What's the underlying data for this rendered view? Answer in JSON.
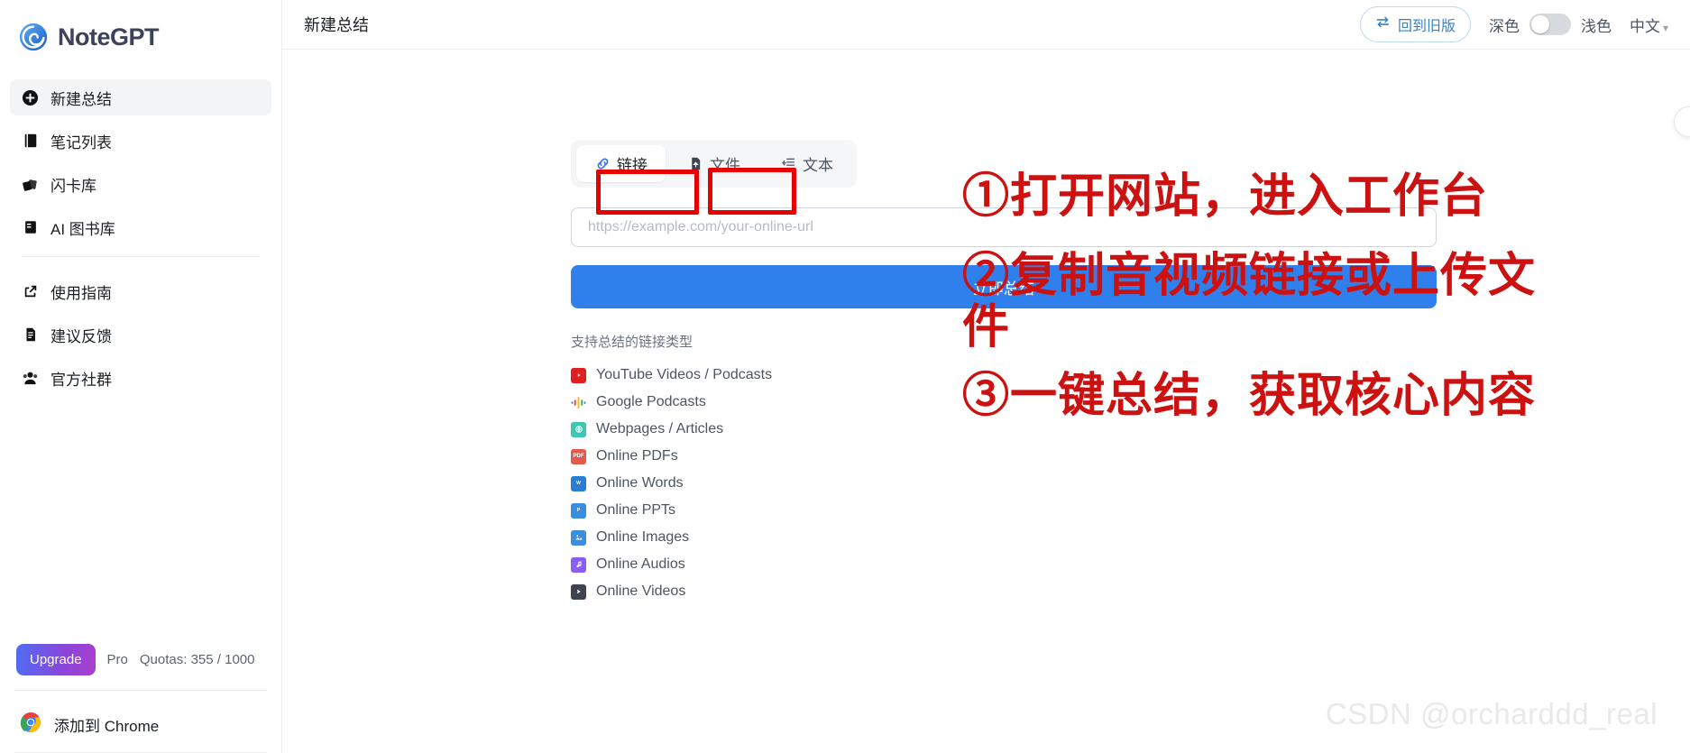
{
  "brand": {
    "name": "NoteGPT",
    "logo_icon": "spiral-logo-icon"
  },
  "sidebar": {
    "primary_items": [
      {
        "label": "新建总结",
        "icon": "plus-circle-icon",
        "active": true
      },
      {
        "label": "笔记列表",
        "icon": "notebook-icon",
        "active": false
      },
      {
        "label": "闪卡库",
        "icon": "flashcards-icon",
        "active": false
      },
      {
        "label": "AI 图书库",
        "icon": "book-icon",
        "active": false
      }
    ],
    "secondary_items": [
      {
        "label": "使用指南",
        "icon": "external-link-icon"
      },
      {
        "label": "建议反馈",
        "icon": "document-icon"
      },
      {
        "label": "官方社群",
        "icon": "users-group-icon"
      }
    ],
    "upgrade_label": "Upgrade",
    "plan_label": "Pro",
    "quota_label": "Quotas: 355 / 1000",
    "chrome_label": "添加到 Chrome",
    "chrome_icon": "chrome-icon"
  },
  "header": {
    "title": "新建总结",
    "legacy_button": {
      "label": "回到旧版",
      "icon": "swap-arrows-icon"
    },
    "theme": {
      "dark_label": "深色",
      "light_label": "浅色",
      "toggle_state": "off"
    },
    "language": {
      "label": "中文",
      "caret": "▾"
    }
  },
  "main": {
    "tabs": [
      {
        "label": "链接",
        "icon": "link-icon",
        "active": true
      },
      {
        "label": "文件",
        "icon": "file-upload-icon",
        "active": false
      },
      {
        "label": "文本",
        "icon": "text-lines-icon",
        "active": false
      }
    ],
    "url_input": {
      "value": "",
      "placeholder": "https://example.com/your-online-url"
    },
    "submit_label": "立即总结",
    "types_title": "支持总结的链接类型",
    "types": [
      {
        "label": "YouTube Videos / Podcasts",
        "icon": "youtube-icon",
        "color": "#e02020"
      },
      {
        "label": "Google Podcasts",
        "icon": "google-podcasts-icon",
        "color": "#f7c948"
      },
      {
        "label": "Webpages / Articles",
        "icon": "webpage-icon",
        "color": "#3fc6b3"
      },
      {
        "label": "Online PDFs",
        "icon": "pdf-icon",
        "color": "#e25b4a"
      },
      {
        "label": "Online Words",
        "icon": "word-icon",
        "color": "#2b7cd3"
      },
      {
        "label": "Online PPTs",
        "icon": "ppt-icon",
        "color": "#3a8edd"
      },
      {
        "label": "Online Images",
        "icon": "image-icon",
        "color": "#3a8edd"
      },
      {
        "label": "Online Audios",
        "icon": "audio-icon",
        "color": "#8b5cf6"
      },
      {
        "label": "Online Videos",
        "icon": "video-icon",
        "color": "#3f4450"
      }
    ]
  },
  "annotations": {
    "accent_color": "#cc1111",
    "box_color": "#e60000",
    "steps": [
      "①打开网站，进入工作台",
      "②复制音视频链接或上传文",
      "件",
      "③一键总结，获取核心内容"
    ]
  },
  "watermark": {
    "text": "CSDN @orcharddd_real"
  }
}
